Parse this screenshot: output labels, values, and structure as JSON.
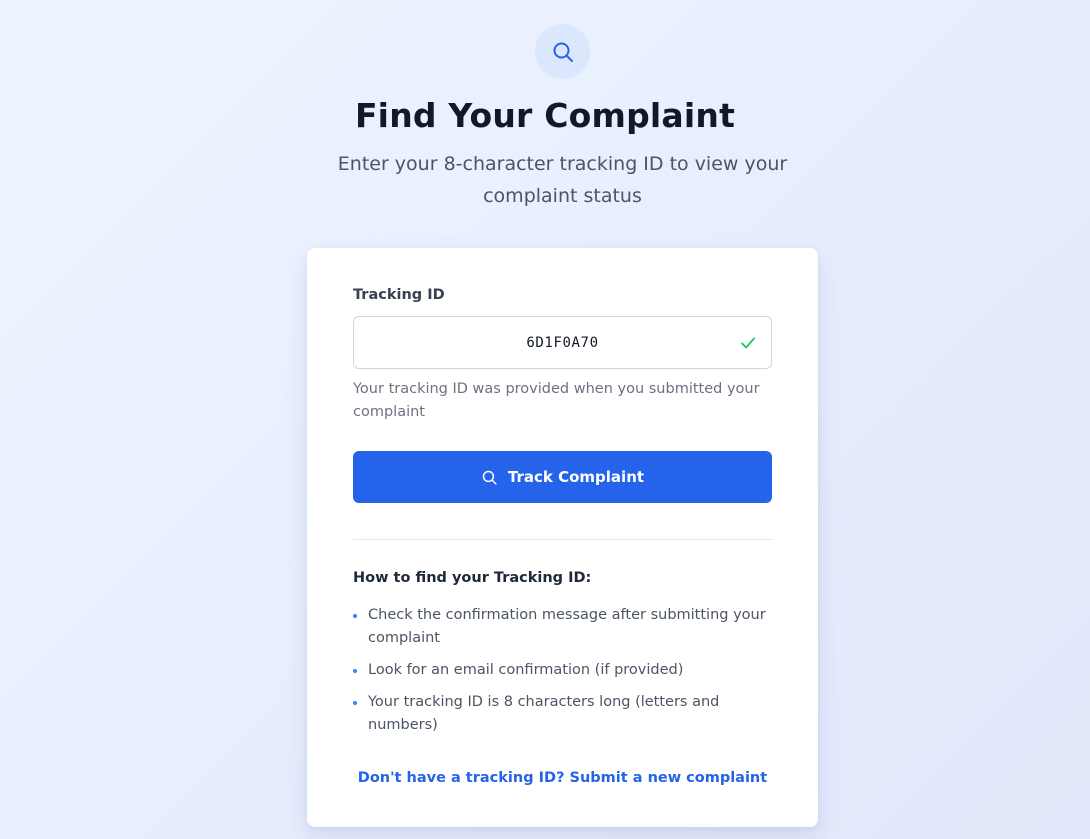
{
  "header": {
    "icon": "search-icon",
    "title": "Find Your Complaint",
    "subtitle": "Enter your 8-character tracking ID to view your complaint status"
  },
  "form": {
    "label": "Tracking ID",
    "input_value": "6D1F0A70",
    "valid_icon": "check-icon",
    "help_text": "Your tracking ID was provided when you submitted your complaint",
    "submit_label": "Track Complaint",
    "submit_icon": "search-icon"
  },
  "howto": {
    "title": "How to find your Tracking ID:",
    "items": [
      "Check the confirmation message after submitting your complaint",
      "Look for an email confirmation (if provided)",
      "Your tracking ID is 8 characters long (letters and numbers)"
    ]
  },
  "footer": {
    "link_text": "Don't have a tracking ID? Submit a new complaint"
  },
  "colors": {
    "accent": "#2563eb",
    "success": "#22c55e",
    "icon_bg": "#dbe7fd"
  }
}
